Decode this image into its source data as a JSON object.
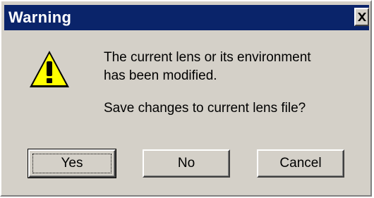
{
  "window": {
    "title": "Warning",
    "close_icon": "close-x-icon",
    "titlebar_color": "#0a246a"
  },
  "icon": {
    "name": "warning-exclamation-icon",
    "color": "#ffff00"
  },
  "message": {
    "line1": "The current lens or its environment",
    "line2": "has been modified.",
    "question": "Save changes to current lens file?"
  },
  "buttons": {
    "yes": "Yes",
    "no": "No",
    "cancel": "Cancel"
  }
}
